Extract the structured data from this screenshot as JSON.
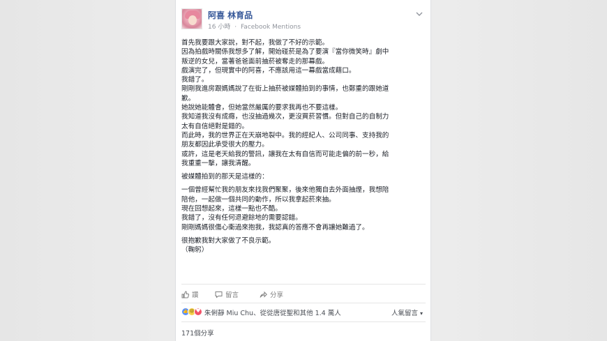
{
  "post": {
    "page_name": "阿喜 林育品",
    "time": "16 小時",
    "separator": "·",
    "source": "Facebook Mentions",
    "body_lines": [
      "首先我要跟大家說，對不起，我做了不好的示範。",
      "因為拍戲時關係我想多了解，開始碰菸是為了要演『當你微笑時』劇中",
      "叛逆的女兒，當著爸爸面前抽菸被奪走的那幕戲。",
      "戲演完了，但現實中的阿喜，不應該用這一幕戲當成藉口。",
      "我錯了。",
      "剛剛我進房跟媽媽說了在街上抽菸被媒體拍到的事情，也鄭重的跟她道",
      "歉。",
      "她說她能體會，但她當然嚴厲的要求我再也不要這樣。",
      "我知道我沒有成癮，也沒抽過幾次，更沒買菸習慣。但對自己的自制力",
      "太有自信絕對是錯的。",
      "而此時，我的世界正在天崩地裂中。我的經紀人、公司同事、支持我的",
      "朋友都因此承受很大的壓力。",
      "或許，這是老天給我的警訊，讓我在太有自信而可能走偏的前一秒，給",
      "我重重一擊，讓我清醒。"
    ],
    "body_lines_2": [
      "被媒體拍到的那天是這樣的："
    ],
    "body_lines_3": [
      "一個曾經幫忙我的朋友來找我們聚聚，後來他獨自去外面抽煙，我想陪",
      "陪他，一起做一個共同的動作，所以我拿起菸來抽。",
      "現在回想起來，這樣一點也不酷。",
      "我錯了，沒有任何退避餘地的需要認錯。",
      "剛剛媽媽很傷心衝過來抱我，我認真的答應不會再讓她難過了。"
    ],
    "body_lines_4": [
      "很抱歉我對大家做了不良示範。",
      "（鞠躬）"
    ]
  },
  "actions": {
    "like": "讚",
    "comment": "留言",
    "share": "分享"
  },
  "reactions": {
    "summary": "朱俐靜 Miu Chu、從從唐從聖和其他 1.4 萬人",
    "sort_label": "人氣留言",
    "sort_arrow": "▾",
    "like_glyph": "👍",
    "sad_glyph": "😢",
    "love_glyph": "♥"
  },
  "shares": {
    "label": "171個分享"
  },
  "colors": {
    "name_link": "#365899",
    "meta_gray": "#90949c",
    "body_text": "#1d2129",
    "like_blue": "#5890ff",
    "sad_yellow": "#f7d34a",
    "love_red": "#f25268"
  },
  "icons": [
    "chevron-down-icon",
    "like-icon",
    "comment-icon",
    "share-icon",
    "globe-icon"
  ]
}
